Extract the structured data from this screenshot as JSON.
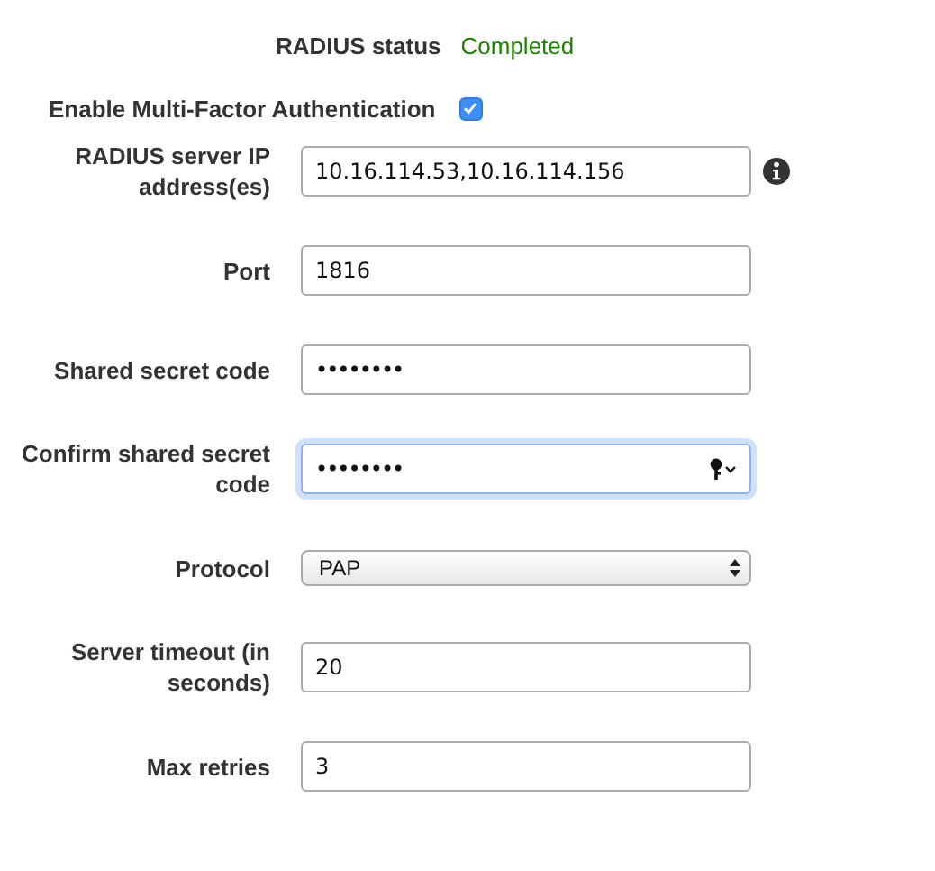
{
  "radius_status": {
    "label": "RADIUS status",
    "value": "Completed"
  },
  "mfa": {
    "label": "Enable Multi-Factor Authentication",
    "checked": true
  },
  "fields": [
    {
      "kind": "text",
      "label": "RADIUS server IP address(es)",
      "value": "10.16.114.53,10.16.114.156",
      "info": true,
      "focused": false
    },
    {
      "kind": "text",
      "label": "Port",
      "value": "1816",
      "info": false,
      "focused": false
    },
    {
      "kind": "password",
      "label": "Shared secret code",
      "value": "••••••••",
      "info": false,
      "focused": false
    },
    {
      "kind": "password",
      "label": "Confirm shared secret code",
      "value": "••••••••",
      "info": false,
      "focused": true
    },
    {
      "kind": "select",
      "label": "Protocol",
      "value": "PAP",
      "info": false,
      "focused": false
    },
    {
      "kind": "text",
      "label": "Server timeout (in seconds)",
      "value": "20",
      "info": false,
      "focused": false
    },
    {
      "kind": "text",
      "label": "Max retries",
      "value": "3",
      "info": false,
      "focused": false
    }
  ]
}
